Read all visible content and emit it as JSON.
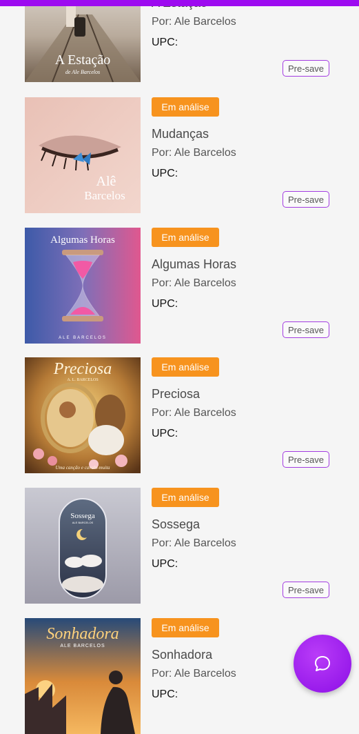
{
  "upc_label": "UPC:",
  "presave_label": "Pre-save",
  "status_label": "Em análise",
  "releases": [
    {
      "title": "A Estação",
      "artist": "Por: Ale Barcelos",
      "cover_title": "A Estação",
      "cover_subtitle": "de Ale Barcelos"
    },
    {
      "title": "Mudanças",
      "artist": "Por: Ale Barcelos",
      "cover_title": "Alê",
      "cover_subtitle": "Barcelos"
    },
    {
      "title": "Algumas Horas",
      "artist": "Por: Ale Barcelos",
      "cover_title": "Algumas Horas",
      "cover_subtitle": "ALE BARCELOS"
    },
    {
      "title": "Preciosa",
      "artist": "Por: Ale Barcelos",
      "cover_title": "Preciosa",
      "cover_subtitle": "A. L. BARCELOS",
      "cover_tagline": "Uma canção e cavalo-muita"
    },
    {
      "title": "Sossega",
      "artist": "Por: Ale Barcelos",
      "cover_title": "Sossega",
      "cover_subtitle": "ALE BARCELOS"
    },
    {
      "title": "Sonhadora",
      "artist": "Por: Ale Barcelos",
      "cover_title": "Sonhadora",
      "cover_subtitle": "ALE BARCELOS"
    }
  ],
  "colors": {
    "accent": "#9d0af0",
    "badge": "#f7931e",
    "presave_border": "#a23be0"
  },
  "chat_button_icon": "chat-bubble-icon"
}
